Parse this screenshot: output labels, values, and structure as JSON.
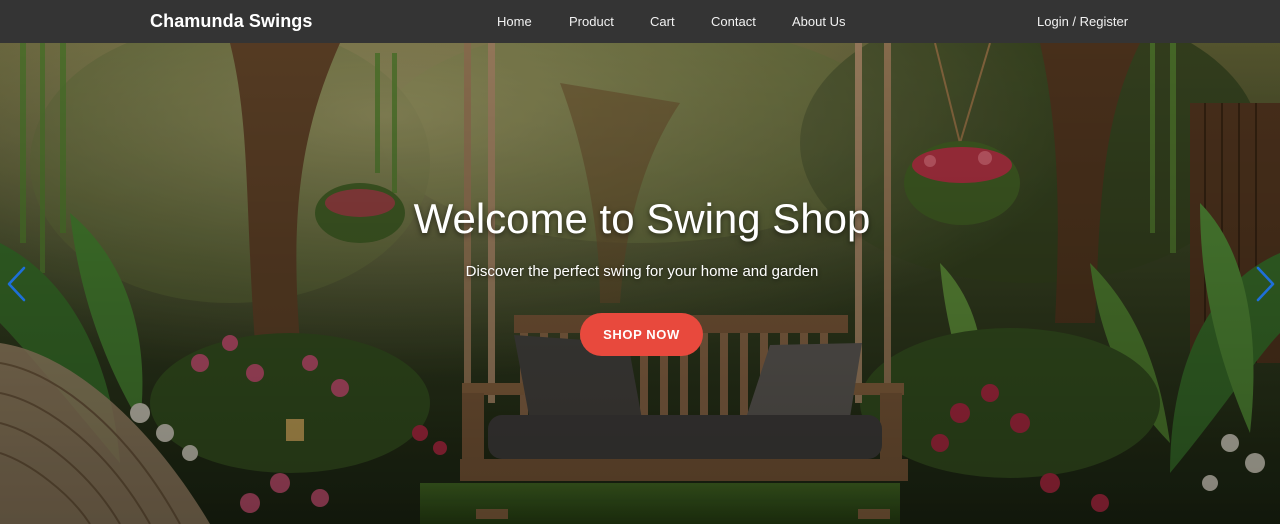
{
  "navbar": {
    "brand": "Chamunda Swings",
    "links": [
      {
        "label": "Home"
      },
      {
        "label": "Product"
      },
      {
        "label": "Cart"
      },
      {
        "label": "Contact"
      },
      {
        "label": "About Us"
      }
    ],
    "login_label": "Login / Register"
  },
  "hero": {
    "title": "Welcome to Swing Shop",
    "subtitle": "Discover the perfect swing for your home and garden",
    "cta_label": "SHOP NOW",
    "accent_color": "#e8493d",
    "arrow_color": "#1e6fd9",
    "prev_icon": "chevron-left-icon",
    "next_icon": "chevron-right-icon",
    "image_alt": "garden swing bench among trees and flowers"
  }
}
